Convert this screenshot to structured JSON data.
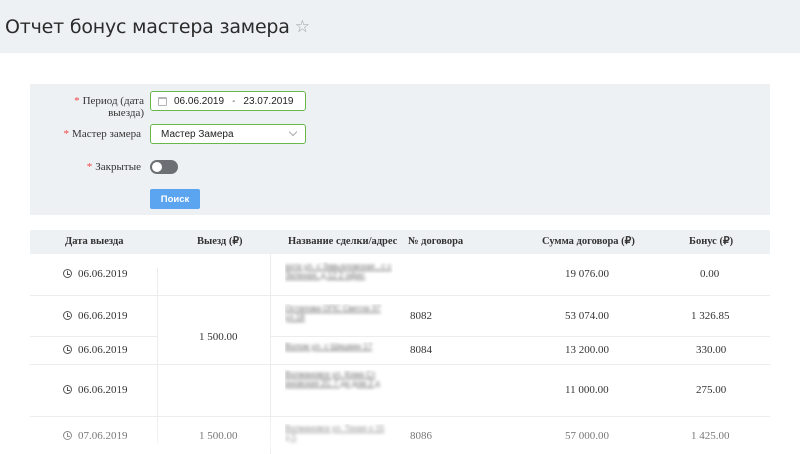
{
  "page": {
    "title": "Отчет бонус мастера замера"
  },
  "filters": {
    "period_label": "Период (дата выезда)",
    "date_from": "06.06.2019",
    "date_sep": "-",
    "date_to": "23.07.2019",
    "master_label": "Мастер замера",
    "master_value": "Мастер Замера",
    "closed_label": "Закрытые",
    "closed_on": false,
    "search_label": "Поиск"
  },
  "table": {
    "headers": [
      "Дата выезда",
      "Выезд (₽)",
      "Название сделки/адрес",
      "№ договора",
      "Сумма договора (₽)",
      "Бонус (₽)"
    ],
    "rows": [
      {
        "date": "06.06.2019",
        "trip": "",
        "name": "ахта ул. с Завьяловская , с с Зеленая, д.12 2 офис",
        "contract": "",
        "sum": "19 076.00",
        "bonus": "0.00"
      },
      {
        "date": "06.06.2019",
        "trip": "1 500.00",
        "name": "Остапова ОПС Светла 37 ул.18",
        "contract": "8082",
        "sum": "53 074.00",
        "bonus": "1 326.85"
      },
      {
        "date": "06.06.2019",
        "trip": "",
        "name": "Волож ул. с Шишкин 17",
        "contract": "8084",
        "sum": "13 200.00",
        "bonus": "330.00"
      },
      {
        "date": "06.06.2019",
        "trip": "",
        "name": "Волжановск ул. Кома Ст ановская 2С 7 ди дом 2 д",
        "contract": "",
        "sum": "11 000.00",
        "bonus": "275.00"
      },
      {
        "date": "07.06.2019",
        "trip": "1 500.00",
        "name": "Волжановск ул. Тихая о 15 д.5",
        "contract": "8086",
        "sum": "57 000.00",
        "bonus": "1 425.00"
      }
    ]
  },
  "colors": {
    "accent": "#5aa4f0",
    "field_border": "#66b84a",
    "panel_bg": "#eef1f4"
  }
}
